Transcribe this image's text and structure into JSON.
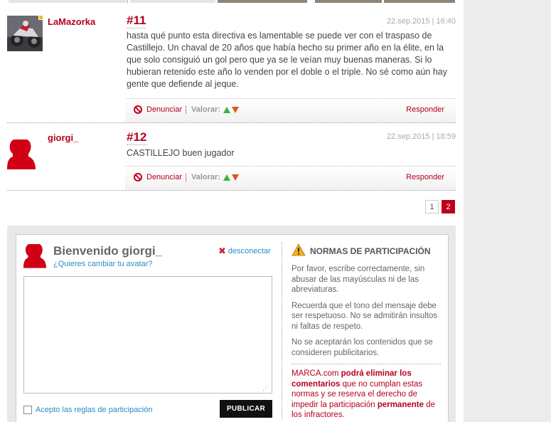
{
  "comments": [
    {
      "username": "LaMazorka",
      "number": "#11",
      "date": "22.sep.2015 | 16:40",
      "text": "hasta qué punto esta directiva es lamentable se puede ver con el traspaso de Castillejo. Un chaval de 20 años que había hecho su primer año en la élite, en la que solo consiguió un gol pero que ya se le veían muy buenas maneras. Si lo hubieran retenido este año lo venden por el doble o el triple. No sé como aún hay gente que defiende al jeque.",
      "report": "Denunciar",
      "rate": "Valorar:",
      "reply": "Responder"
    },
    {
      "username": "giorgi_",
      "number": "#12",
      "date": "22.sep.2015 | 18:59",
      "text": "CASTILLEJO buen jugador",
      "report": "Denunciar",
      "rate": "Valorar:",
      "reply": "Responder"
    }
  ],
  "pagination": {
    "pages": [
      "1",
      "2"
    ],
    "current": "2"
  },
  "form": {
    "welcome": "Bienvenido giorgi_",
    "change_avatar": "¿Quieres cambiar tu avatar?",
    "disconnect": "desconectar",
    "textarea_value": "",
    "accept_rules": "Acepto las reglas de participación",
    "publish": "PUBLICAR"
  },
  "rules": {
    "title": "NORMAS DE PARTICIPACIÓN",
    "p1": "Por favor, escribe correctamente, sin abusar de las mayúsculas ni de las abreviaturas.",
    "p2": "Recuerda que el tono del mensaje debe ser respetuoso. No se admitirán insultos ni faltas de respeto.",
    "p3": "No se aceptarán los contenidos que se consideren publicitarios.",
    "final_a": "MARCA.com ",
    "final_b": "podrá eliminar los comentarios",
    "final_c": " que no cumplan estas normas y se reserva el derecho de impedir la participación ",
    "final_d": "permanente",
    "final_e": " de los infractores."
  },
  "colors": {
    "accent": "#b5001d",
    "link": "#2a8cc4"
  }
}
